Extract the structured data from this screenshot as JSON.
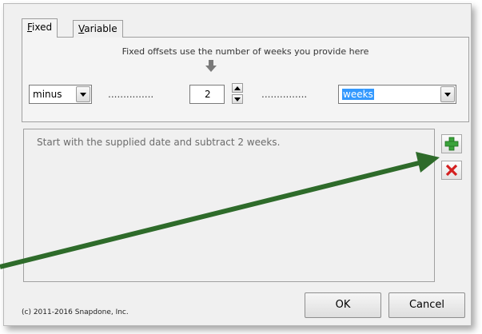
{
  "tabs": [
    {
      "label": "Fixed",
      "mnemonic": "F",
      "rest": "ixed",
      "selected": true
    },
    {
      "label": "Variable",
      "mnemonic": "V",
      "rest": "ariable",
      "selected": false
    }
  ],
  "fixed_panel": {
    "hint": "Fixed offsets use the number of weeks you provide here",
    "operation": "minus",
    "dots": "...............",
    "amount": "2",
    "unit": "weeks"
  },
  "description": "Start with the supplied date and subtract 2 weeks.",
  "copyright": "(c) 2011-2016 Snapdone, Inc.",
  "buttons": {
    "ok": "OK",
    "cancel": "Cancel"
  },
  "colors": {
    "annotation_arrow": "#2e6b2a",
    "add_icon": "#3aa23a",
    "delete_icon": "#d42020",
    "selection": "#3399ff"
  }
}
